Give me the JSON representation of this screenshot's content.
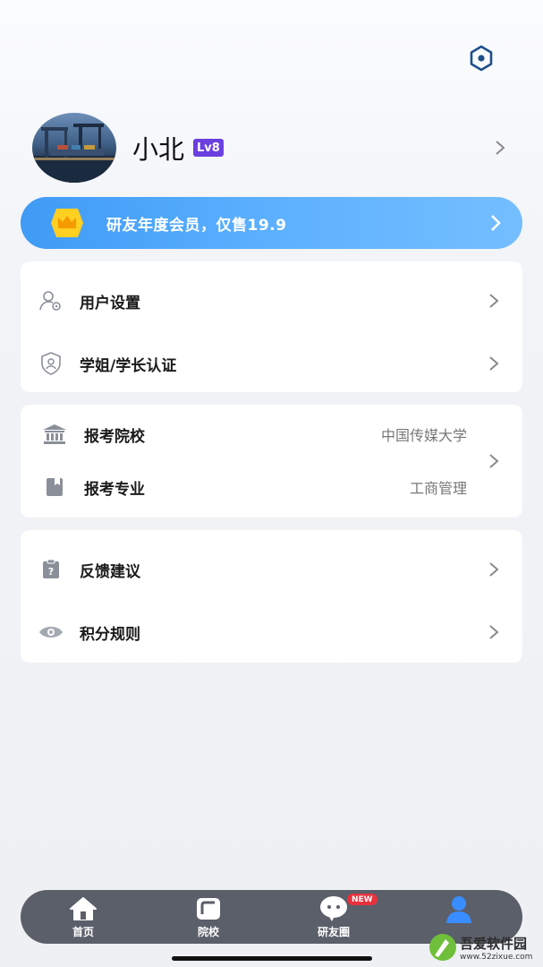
{
  "profile": {
    "name": "小北",
    "level": "Lv8"
  },
  "vip_banner": {
    "text": "研友年度会员，仅售19.9"
  },
  "menu_group_1": [
    {
      "label": "用户设置",
      "icon": "user-settings-icon"
    },
    {
      "label": "学姐/学长认证",
      "icon": "shield-user-icon"
    }
  ],
  "menu_group_2": [
    {
      "label": "报考院校",
      "value": "中国传媒大学",
      "icon": "university-icon"
    },
    {
      "label": "报考专业",
      "value": "工商管理",
      "icon": "book-icon"
    }
  ],
  "menu_group_3": [
    {
      "label": "反馈建议",
      "icon": "feedback-icon"
    },
    {
      "label": "积分规则",
      "icon": "eye-icon"
    }
  ],
  "tabbar": {
    "tabs": [
      {
        "label": "首页",
        "icon": "home-icon"
      },
      {
        "label": "院校",
        "icon": "school-icon"
      },
      {
        "label": "研友圈",
        "icon": "chat-icon"
      },
      {
        "label": "",
        "icon": "profile-icon"
      }
    ],
    "new_badge": "NEW"
  },
  "watermark": {
    "title": "吾爱软件园",
    "url": "www.52zixue.com"
  },
  "colors": {
    "accent_blue": "#4aa5f8",
    "level_purple": "#6b3fe0",
    "tabbar_bg": "#5b5f6a",
    "active_tab": "#3a8dff",
    "badge_red": "#e8313d"
  }
}
